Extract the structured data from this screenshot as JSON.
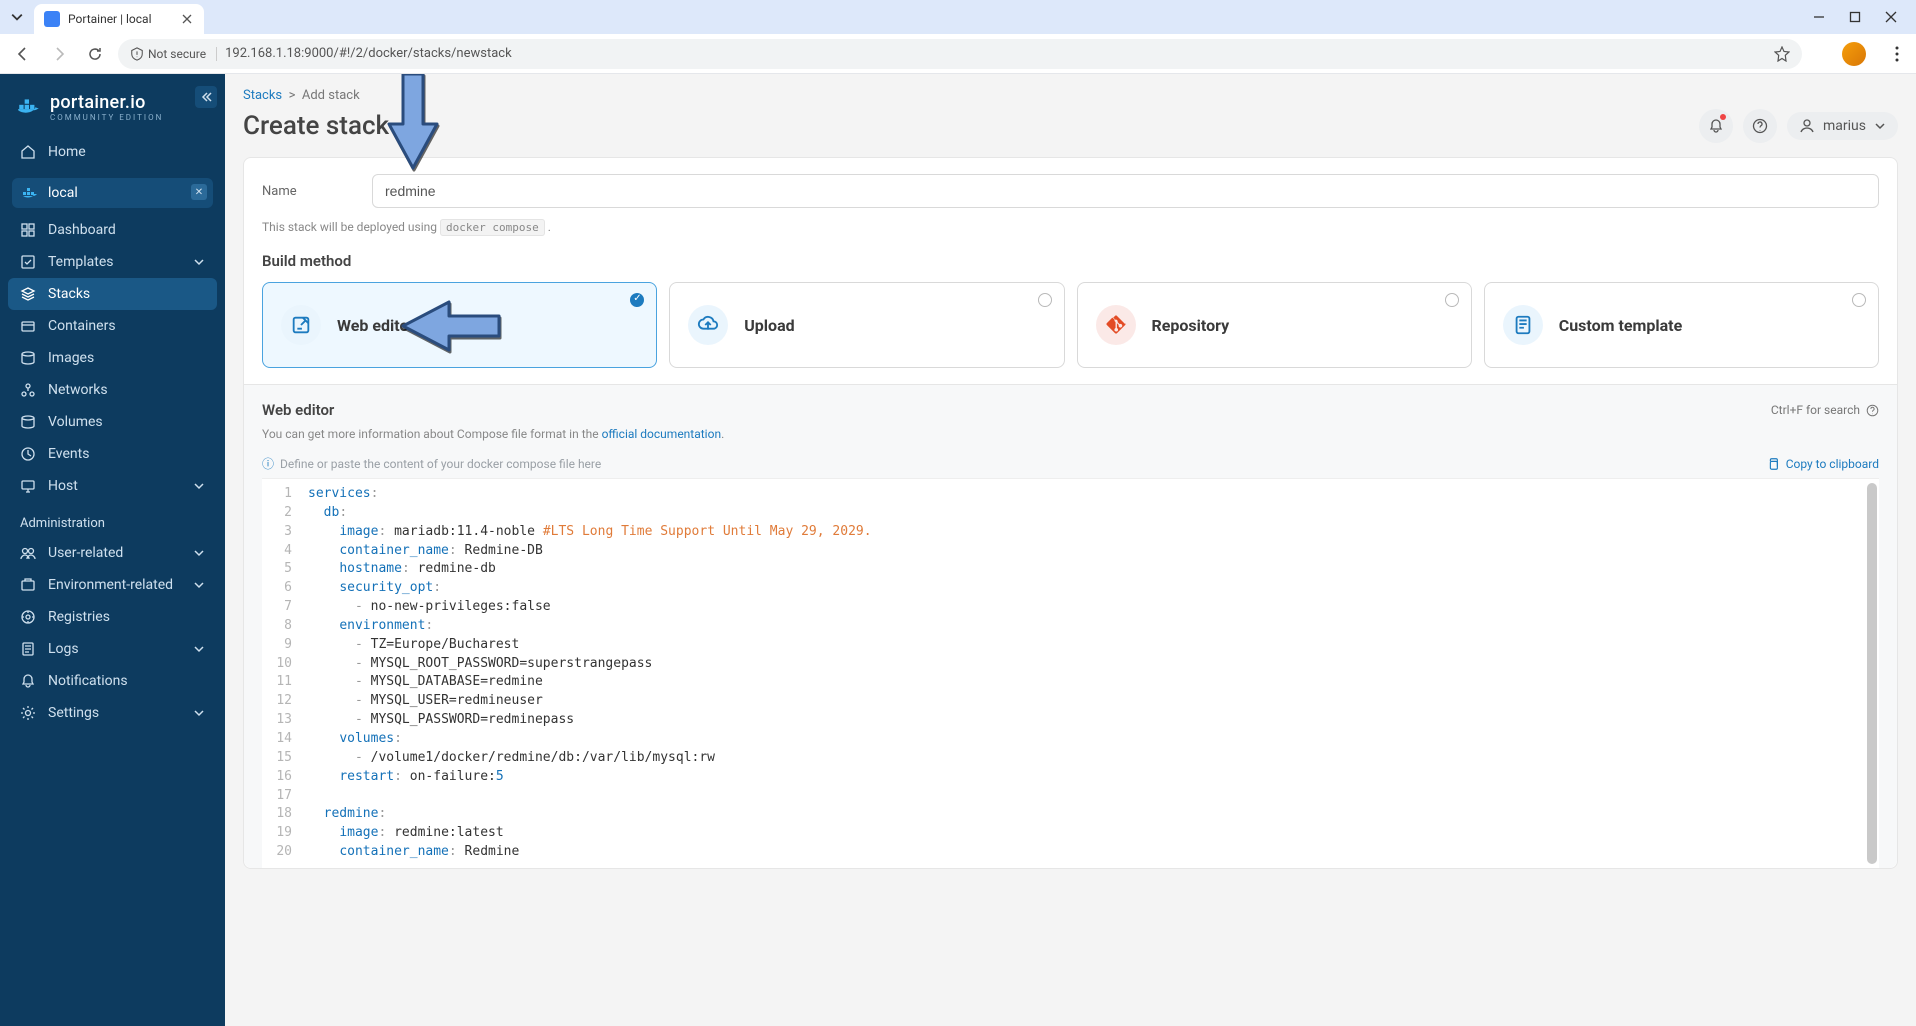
{
  "browser": {
    "tab_title": "Portainer | local",
    "not_secure": "Not secure",
    "url": "192.168.1.18:9000/#!/2/docker/stacks/newstack"
  },
  "sidebar": {
    "brand": "portainer.io",
    "brand_sub": "COMMUNITY EDITION",
    "home": "Home",
    "env_name": "local",
    "items": [
      {
        "label": "Dashboard"
      },
      {
        "label": "Templates",
        "expandable": true
      },
      {
        "label": "Stacks",
        "active": true
      },
      {
        "label": "Containers"
      },
      {
        "label": "Images"
      },
      {
        "label": "Networks"
      },
      {
        "label": "Volumes"
      },
      {
        "label": "Events"
      },
      {
        "label": "Host",
        "expandable": true
      }
    ],
    "admin_label": "Administration",
    "admin_items": [
      {
        "label": "User-related",
        "expandable": true
      },
      {
        "label": "Environment-related",
        "expandable": true
      },
      {
        "label": "Registries"
      },
      {
        "label": "Logs",
        "expandable": true
      },
      {
        "label": "Notifications"
      },
      {
        "label": "Settings",
        "expandable": true
      }
    ]
  },
  "header": {
    "breadcrumb_root": "Stacks",
    "breadcrumb_leaf": "Add stack",
    "title": "Create stack",
    "user": "marius"
  },
  "form": {
    "name_label": "Name",
    "name_value": "redmine",
    "deploy_hint_pre": "This stack will be deployed using ",
    "deploy_hint_code": "docker compose",
    "deploy_hint_post": " .",
    "build_method_label": "Build method",
    "methods": [
      {
        "label": "Web editor",
        "selected": true
      },
      {
        "label": "Upload"
      },
      {
        "label": "Repository"
      },
      {
        "label": "Custom template"
      }
    ]
  },
  "editor": {
    "title": "Web editor",
    "search_hint": "Ctrl+F for search",
    "desc_pre": "You can get more information about Compose file format in the ",
    "desc_link": "official documentation",
    "desc_post": ".",
    "placeholder_hint": "Define or paste the content of your docker compose file here",
    "copy_label": "Copy to clipboard",
    "lines": [
      [
        {
          "t": "key",
          "v": "services"
        },
        {
          "t": "p",
          "v": ":"
        }
      ],
      [
        {
          "t": "sp",
          "v": "  "
        },
        {
          "t": "key",
          "v": "db"
        },
        {
          "t": "p",
          "v": ":"
        }
      ],
      [
        {
          "t": "sp",
          "v": "    "
        },
        {
          "t": "key",
          "v": "image"
        },
        {
          "t": "p",
          "v": ": "
        },
        {
          "t": "str",
          "v": "mariadb:11.4-noble "
        },
        {
          "t": "c",
          "v": "#LTS Long Time Support Until May 29, 2029."
        }
      ],
      [
        {
          "t": "sp",
          "v": "    "
        },
        {
          "t": "key",
          "v": "container_name"
        },
        {
          "t": "p",
          "v": ": "
        },
        {
          "t": "str",
          "v": "Redmine-DB"
        }
      ],
      [
        {
          "t": "sp",
          "v": "    "
        },
        {
          "t": "key",
          "v": "hostname"
        },
        {
          "t": "p",
          "v": ": "
        },
        {
          "t": "str",
          "v": "redmine-db"
        }
      ],
      [
        {
          "t": "sp",
          "v": "    "
        },
        {
          "t": "key",
          "v": "security_opt"
        },
        {
          "t": "p",
          "v": ":"
        }
      ],
      [
        {
          "t": "sp",
          "v": "      "
        },
        {
          "t": "p",
          "v": "- "
        },
        {
          "t": "str",
          "v": "no-new-privileges:false"
        }
      ],
      [
        {
          "t": "sp",
          "v": "    "
        },
        {
          "t": "key",
          "v": "environment"
        },
        {
          "t": "p",
          "v": ":"
        }
      ],
      [
        {
          "t": "sp",
          "v": "      "
        },
        {
          "t": "p",
          "v": "- "
        },
        {
          "t": "str",
          "v": "TZ=Europe/Bucharest"
        }
      ],
      [
        {
          "t": "sp",
          "v": "      "
        },
        {
          "t": "p",
          "v": "- "
        },
        {
          "t": "str",
          "v": "MYSQL_ROOT_PASSWORD=superstrangepass"
        }
      ],
      [
        {
          "t": "sp",
          "v": "      "
        },
        {
          "t": "p",
          "v": "- "
        },
        {
          "t": "str",
          "v": "MYSQL_DATABASE=redmine"
        }
      ],
      [
        {
          "t": "sp",
          "v": "      "
        },
        {
          "t": "p",
          "v": "- "
        },
        {
          "t": "str",
          "v": "MYSQL_USER=redmineuser"
        }
      ],
      [
        {
          "t": "sp",
          "v": "      "
        },
        {
          "t": "p",
          "v": "- "
        },
        {
          "t": "str",
          "v": "MYSQL_PASSWORD=redminepass"
        }
      ],
      [
        {
          "t": "sp",
          "v": "    "
        },
        {
          "t": "key",
          "v": "volumes"
        },
        {
          "t": "p",
          "v": ":"
        }
      ],
      [
        {
          "t": "sp",
          "v": "      "
        },
        {
          "t": "p",
          "v": "- "
        },
        {
          "t": "str",
          "v": "/volume1/docker/redmine/db:/var/lib/mysql:rw"
        }
      ],
      [
        {
          "t": "sp",
          "v": "    "
        },
        {
          "t": "key",
          "v": "restart"
        },
        {
          "t": "p",
          "v": ": "
        },
        {
          "t": "str",
          "v": "on-failure:"
        },
        {
          "t": "num",
          "v": "5"
        }
      ],
      [],
      [
        {
          "t": "sp",
          "v": "  "
        },
        {
          "t": "key",
          "v": "redmine"
        },
        {
          "t": "p",
          "v": ":"
        }
      ],
      [
        {
          "t": "sp",
          "v": "    "
        },
        {
          "t": "key",
          "v": "image"
        },
        {
          "t": "p",
          "v": ": "
        },
        {
          "t": "str",
          "v": "redmine:latest"
        }
      ],
      [
        {
          "t": "sp",
          "v": "    "
        },
        {
          "t": "key",
          "v": "container_name"
        },
        {
          "t": "p",
          "v": ": "
        },
        {
          "t": "str",
          "v": "Redmine"
        }
      ]
    ]
  }
}
